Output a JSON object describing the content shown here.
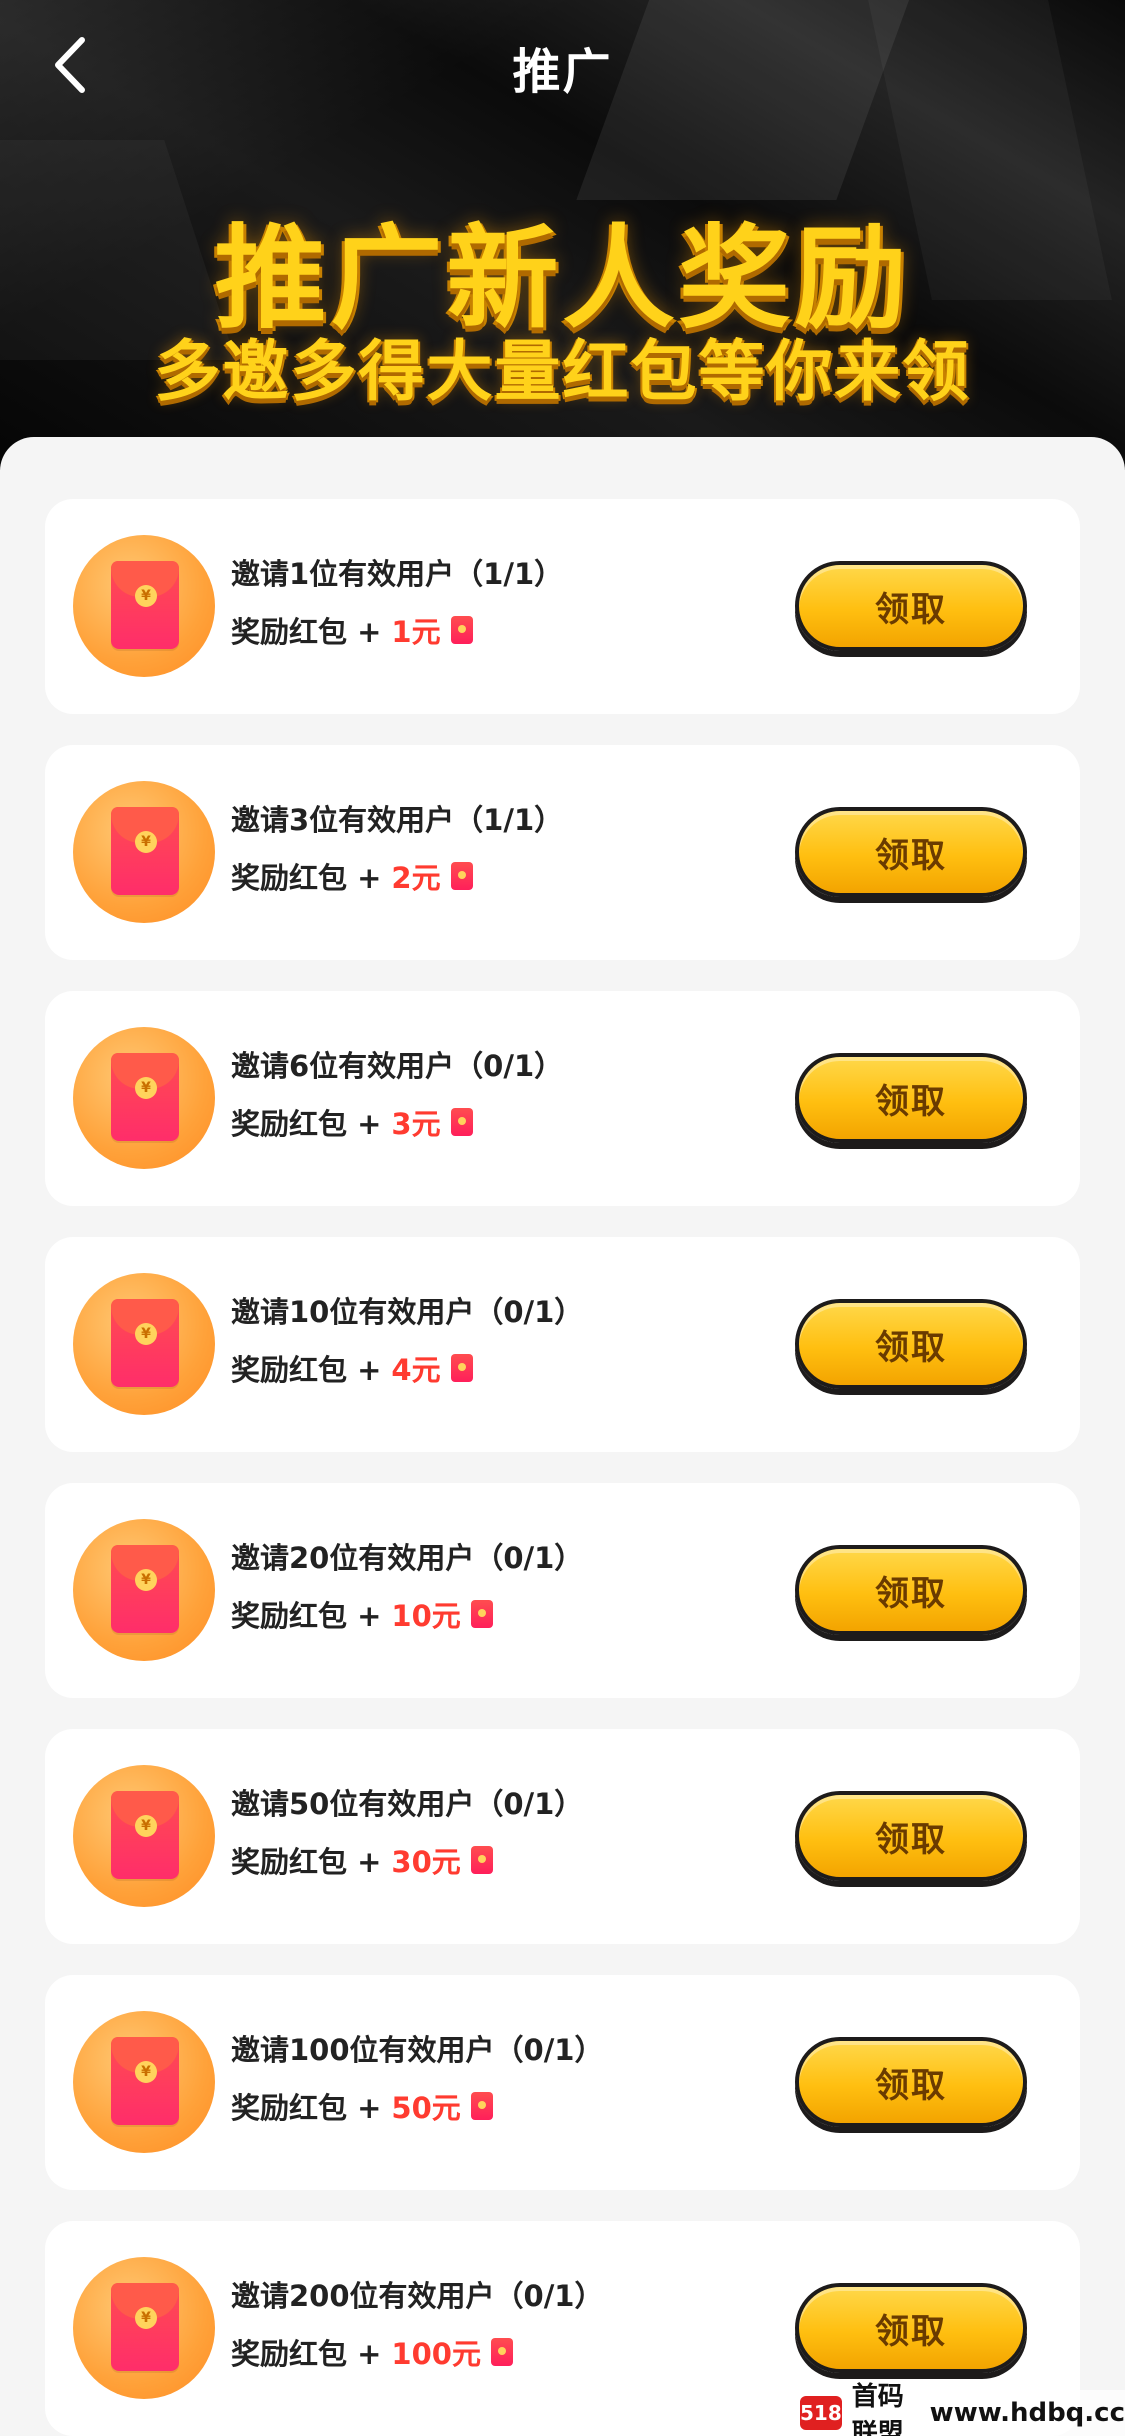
{
  "nav": {
    "title": "推广",
    "back_icon": "chevron-left-icon"
  },
  "hero": {
    "title": "推广新人奖励",
    "subtitle": "多邀多得大量红包等你来领"
  },
  "tasks": [
    {
      "label": "邀请1位有效用户（1/1）",
      "reward_prefix": "奖励红包 +",
      "reward": "1元",
      "button": "领取"
    },
    {
      "label": "邀请3位有效用户（1/1）",
      "reward_prefix": "奖励红包 +",
      "reward": "2元",
      "button": "领取"
    },
    {
      "label": "邀请6位有效用户（0/1）",
      "reward_prefix": "奖励红包 +",
      "reward": "3元",
      "button": "领取"
    },
    {
      "label": "邀请10位有效用户（0/1）",
      "reward_prefix": "奖励红包 +",
      "reward": "4元",
      "button": "领取"
    },
    {
      "label": "邀请20位有效用户（0/1）",
      "reward_prefix": "奖励红包 +",
      "reward": "10元",
      "button": "领取"
    },
    {
      "label": "邀请50位有效用户（0/1）",
      "reward_prefix": "奖励红包 +",
      "reward": "30元",
      "button": "领取"
    },
    {
      "label": "邀请100位有效用户（0/1）",
      "reward_prefix": "奖励红包 +",
      "reward": "50元",
      "button": "领取"
    },
    {
      "label": "邀请200位有效用户（0/1）",
      "reward_prefix": "奖励红包 +",
      "reward": "100元",
      "button": "领取"
    }
  ],
  "watermark": {
    "logo": "518",
    "text": "首码联盟",
    "url": "www.hdbq.cc"
  },
  "colors": {
    "accent_gold": "#ffd21a",
    "reward_red": "#ff3b30",
    "banner_bg": "#111111",
    "button_yellow": "#ffbf10"
  }
}
